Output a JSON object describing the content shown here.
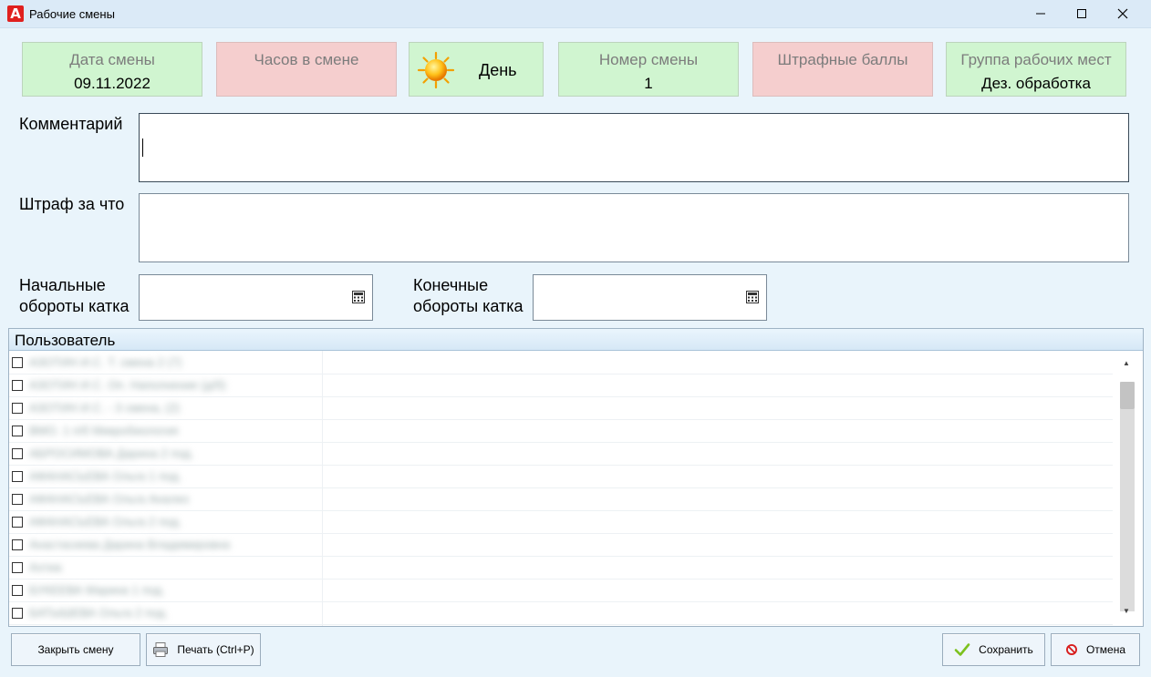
{
  "window": {
    "title": "Рабочие смены"
  },
  "cards": {
    "shift_date": {
      "label": "Дата смены",
      "value": "09.11.2022"
    },
    "hours": {
      "label": "Часов в смене",
      "value": ""
    },
    "shift_type": {
      "value": "День",
      "icon": "sun-icon"
    },
    "shift_number": {
      "label": "Номер смены",
      "value": "1"
    },
    "penalty_points": {
      "label": "Штрафные баллы",
      "value": ""
    },
    "workplace_group": {
      "label": "Группа рабочих мест",
      "value": "Дез. обработка"
    }
  },
  "form": {
    "comment_label": "Комментарий",
    "comment_value": "",
    "penalty_reason_label": "Штраф за что",
    "penalty_reason_value": "",
    "start_rev_label_1": "Начальные",
    "start_rev_label_2": "обороты катка",
    "end_rev_label_1": "Конечные",
    "end_rev_label_2": "обороты катка"
  },
  "users_grid": {
    "column_header": "Пользователь",
    "rows": [
      {
        "name": "АЗОТИН И.С. Т. смена 2 (7)",
        "checked": false
      },
      {
        "name": "АЗОТИН И.С. Оп. Наполнение (д/б)",
        "checked": false
      },
      {
        "name": "АЗОТИН И.С. - 3 смена, (2)",
        "checked": false
      },
      {
        "name": "ВМО. 1 п/б Микробиология",
        "checked": false
      },
      {
        "name": "АБРОСИМОВА Дарина 2 под.",
        "checked": false
      },
      {
        "name": "АФАНАСЬЕВА Ольга 1 под.",
        "checked": false
      },
      {
        "name": "АФАНАСЬЕВА Ольга Анализ",
        "checked": false
      },
      {
        "name": "АФАНАСЬЕВА Ольга 2 под.",
        "checked": false
      },
      {
        "name": "Анастасиева Дарина Владимировна",
        "checked": false
      },
      {
        "name": "Ахтиа",
        "checked": false
      },
      {
        "name": "БУКЕЕВА Марина 1 под.",
        "checked": false
      },
      {
        "name": "БАТЫШЕВА Ольга 2 под.",
        "checked": false
      }
    ]
  },
  "buttons": {
    "close_shift": "Закрыть смену",
    "print": "Печать (Ctrl+P)",
    "save": "Сохранить",
    "cancel": "Отмена"
  },
  "colors": {
    "green_card": "#d0f5d0",
    "pink_card": "#f5cece",
    "background": "#e9f4fb"
  }
}
